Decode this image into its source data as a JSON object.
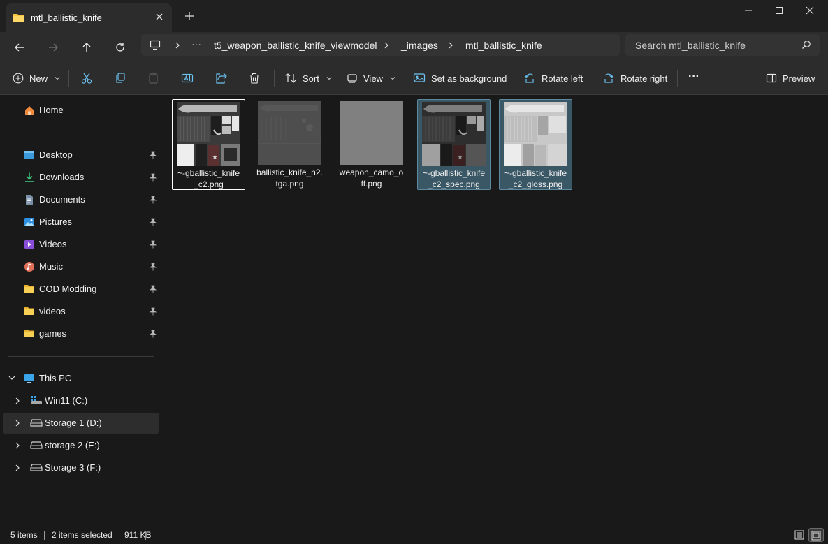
{
  "window": {
    "tab_title": "mtl_ballistic_knife",
    "minimize_label": "Minimize",
    "maximize_label": "Maximize",
    "close_label": "Close"
  },
  "address": {
    "ellipsis": "···",
    "breadcrumbs": [
      "t5_weapon_ballistic_knife_viewmodel",
      "_images",
      "mtl_ballistic_knife"
    ],
    "search_placeholder": "Search mtl_ballistic_knife"
  },
  "toolbar": {
    "new_label": "New",
    "sort_label": "Sort",
    "view_label": "View",
    "set_background_label": "Set as background",
    "rotate_left_label": "Rotate left",
    "rotate_right_label": "Rotate right",
    "more_label": "···",
    "preview_label": "Preview"
  },
  "sidebar": {
    "home": "Home",
    "quick": [
      {
        "label": "Desktop",
        "icon": "desktop-icon"
      },
      {
        "label": "Downloads",
        "icon": "download-icon"
      },
      {
        "label": "Documents",
        "icon": "document-icon"
      },
      {
        "label": "Pictures",
        "icon": "pictures-icon"
      },
      {
        "label": "Videos",
        "icon": "videos-icon"
      },
      {
        "label": "Music",
        "icon": "music-icon"
      },
      {
        "label": "COD Modding",
        "icon": "folder-icon"
      },
      {
        "label": "videos",
        "icon": "folder-icon"
      },
      {
        "label": "games",
        "icon": "folder-icon"
      }
    ],
    "this_pc": "This PC",
    "drives": [
      {
        "label": "Win11 (C:)",
        "selected": false
      },
      {
        "label": "Storage 1 (D:)",
        "selected": true
      },
      {
        "label": "storage 2 (E:)",
        "selected": false
      },
      {
        "label": "Storage 3 (F:)",
        "selected": false
      }
    ]
  },
  "files": [
    {
      "name": "~-gballistic_knife_c2.png",
      "line1": "~-gballistic_knife",
      "line2": "_c2.png",
      "state": "focus",
      "thumb": "texture-color"
    },
    {
      "name": "ballistic_knife_n2.tga.png",
      "line1": "ballistic_knife_n2.",
      "line2": "tga.png",
      "state": "none",
      "thumb": "texture-normal"
    },
    {
      "name": "weapon_camo_off.png",
      "line1": "weapon_camo_o",
      "line2": "ff.png",
      "state": "none",
      "thumb": "texture-flat"
    },
    {
      "name": "~-gballistic_knife_c2_spec.png",
      "line1": "~-gballistic_knife",
      "line2": "_c2_spec.png",
      "state": "selected",
      "thumb": "texture-spec"
    },
    {
      "name": "~-gballistic_knife_c2_gloss.png",
      "line1": "~-gballistic_knife",
      "line2": "_c2_gloss.png",
      "state": "selected",
      "thumb": "texture-gloss"
    }
  ],
  "status": {
    "item_count": "5 items",
    "selection": "2 items selected",
    "size": "911 KB"
  },
  "colors": {
    "accent_selection": "#3a5766",
    "folder_yellow": "#f4c542",
    "background": "#191919"
  }
}
